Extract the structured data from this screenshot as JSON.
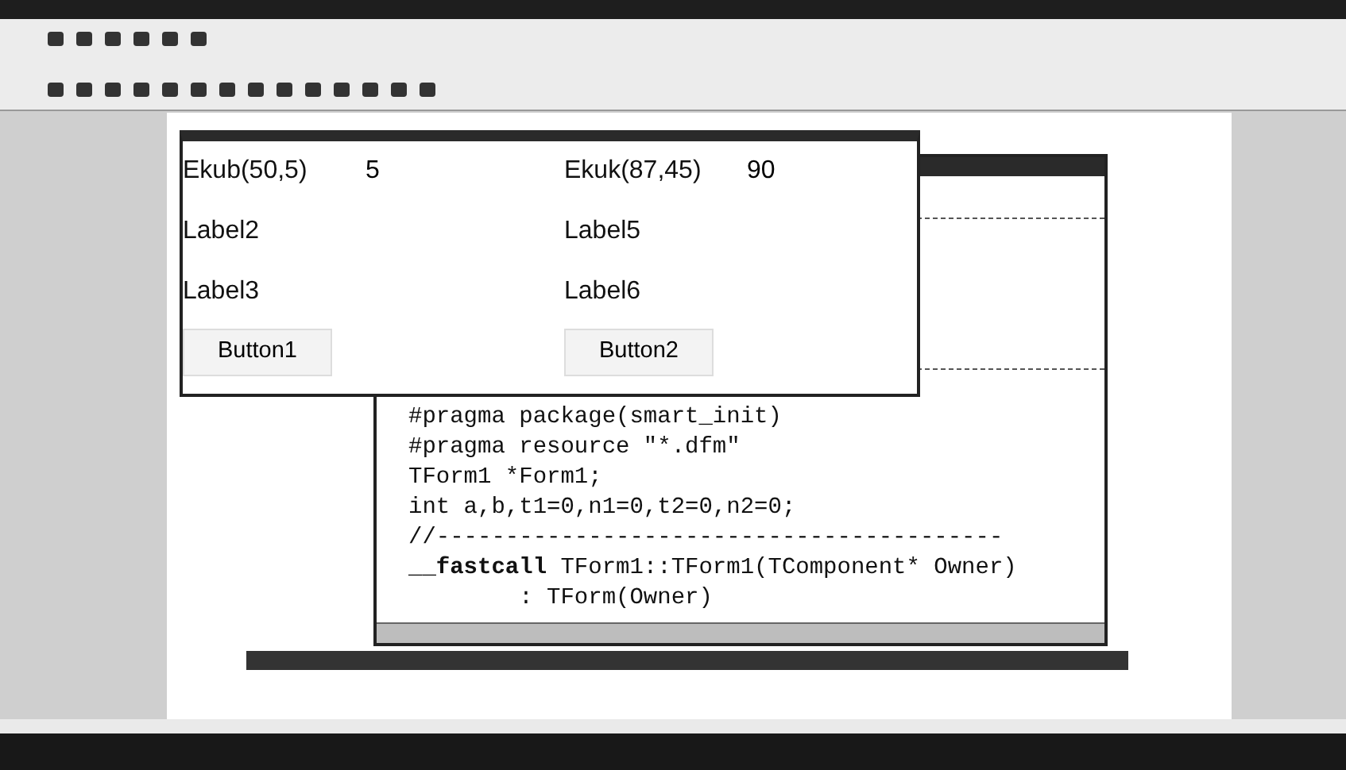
{
  "form": {
    "rows": [
      {
        "left": [
          {
            "kind": "label",
            "text": "Ekub(50,5)"
          },
          {
            "kind": "edit",
            "value": "5"
          }
        ],
        "right": [
          {
            "kind": "label",
            "text": "Ekuk(87,45)"
          },
          {
            "kind": "edit",
            "value": "90"
          }
        ]
      },
      {
        "left": [
          {
            "kind": "label",
            "text": "Label2"
          }
        ],
        "right": [
          {
            "kind": "label",
            "text": "Label5"
          }
        ]
      },
      {
        "left": [
          {
            "kind": "label",
            "text": "Label3"
          }
        ],
        "right": [
          {
            "kind": "label",
            "text": "Label6"
          }
        ]
      },
      {
        "left": [
          {
            "kind": "button",
            "text": "Button1"
          }
        ],
        "right": [
          {
            "kind": "button",
            "text": "Button2"
          }
        ]
      }
    ]
  },
  "editor": {
    "lines": [
      {
        "parts": [
          {
            "text": "#pragma package(smart_init)",
            "bold": false
          }
        ]
      },
      {
        "parts": [
          {
            "text": "#pragma resource \"*.dfm\"",
            "bold": false
          }
        ]
      },
      {
        "parts": [
          {
            "text": "TForm1 *Form1;",
            "bold": false
          }
        ]
      },
      {
        "parts": [
          {
            "text": "int a,b,t1=0,n1=0,t2=0,n2=0;",
            "bold": false
          }
        ]
      },
      {
        "parts": [
          {
            "text": "//-----------------------------------------",
            "bold": false
          }
        ]
      },
      {
        "parts": [
          {
            "text": "__fastcall",
            "bold": true
          },
          {
            "text": " TForm1::TForm1(TComponent* Owner)",
            "bold": false
          }
        ]
      },
      {
        "parts": [
          {
            "text": "        : TForm(Owner)",
            "bold": false
          }
        ]
      }
    ]
  }
}
